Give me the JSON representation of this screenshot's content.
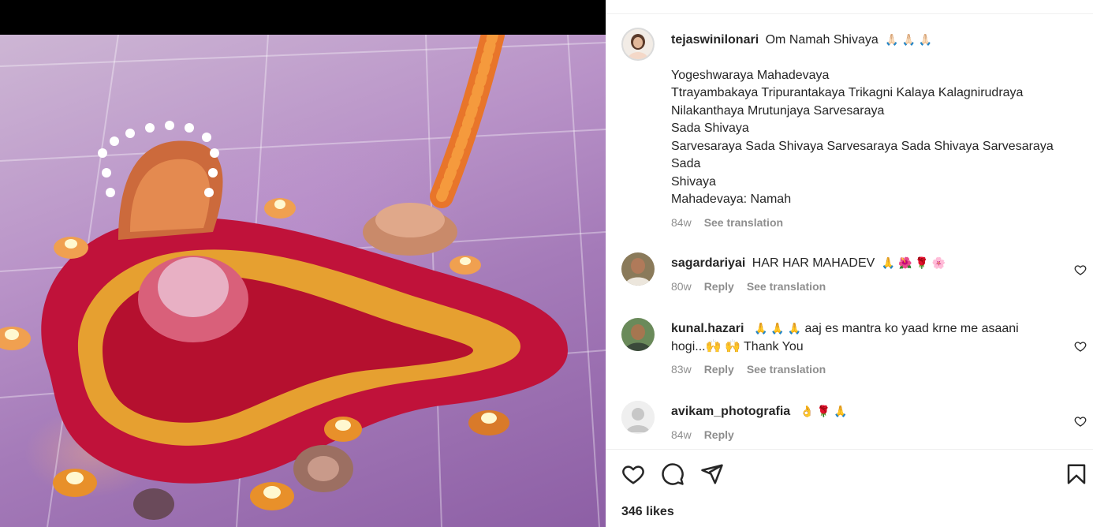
{
  "post": {
    "author": "tejaswinilonari",
    "caption_first": "Om Namah Shivaya",
    "caption_first_emoji": "🙏🏻 🙏🏻 🙏🏻",
    "caption_lines": [
      "Yogeshwaraya Mahadevaya",
      "Ttrayambakaya Tripurantakaya Trikagni Kalaya Kalagnirudraya",
      "Nilakanthaya Mrutunjaya Sarvesaraya",
      "Sada Shivaya",
      "Sarvesaraya Sada Shivaya Sarvesaraya Sada Shivaya Sarvesaraya",
      "Sada",
      "Shivaya",
      "Mahadevaya: Namah"
    ],
    "age": "84w",
    "see_translation": "See translation"
  },
  "comments": [
    {
      "username": "sagardariyai",
      "text": "HAR HAR MAHADEV",
      "emoji": "🙏 🌺 🌹 🌸",
      "age": "80w",
      "reply": "Reply",
      "see_translation": "See translation"
    },
    {
      "username": "kunal.hazari",
      "text_emoji": "🙏 🙏 🙏",
      "text": "aaj es mantra ko yaad krne me asaani",
      "text2": "hogi...🙌 🙌 Thank You",
      "age": "83w",
      "reply": "Reply",
      "see_translation": "See translation"
    },
    {
      "username": "avikam_photografia",
      "emoji": "👌 🌹 🙏",
      "age": "84w",
      "reply": "Reply"
    }
  ],
  "likes": "346 likes",
  "icons": {
    "like": "heart-icon",
    "comment": "comment-icon",
    "share": "share-icon",
    "save": "bookmark-icon"
  },
  "colors": {
    "text": "#262626",
    "secondary": "#8e8e8e",
    "border": "#efefef"
  }
}
